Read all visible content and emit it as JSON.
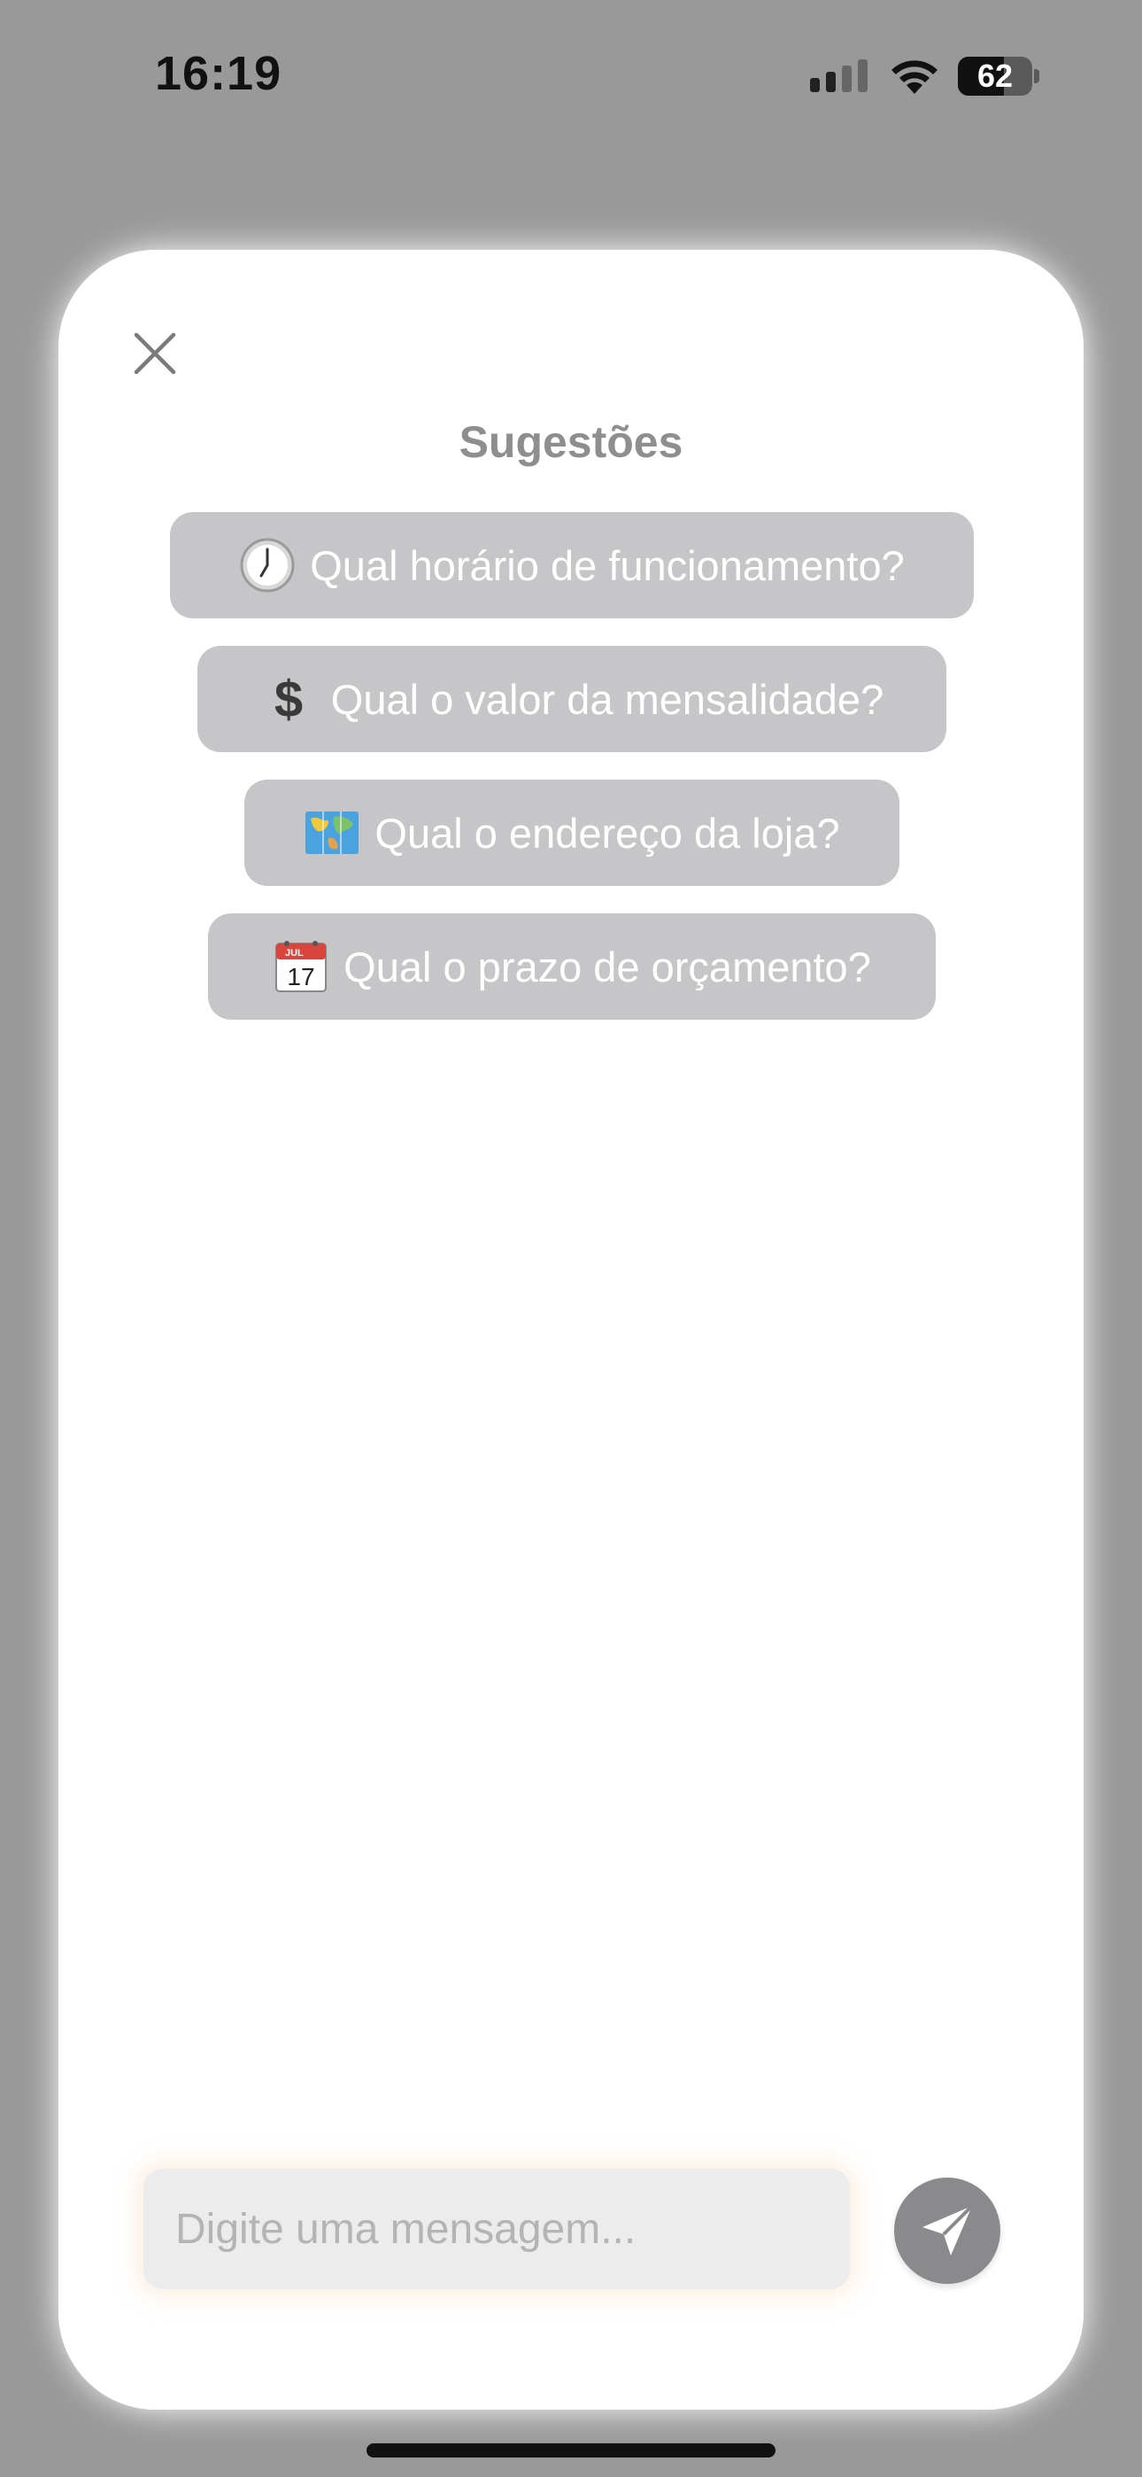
{
  "status_bar": {
    "time": "16:19",
    "battery_percent": "62",
    "battery_level": 0.62
  },
  "dialog": {
    "title": "Sugestões",
    "suggestions": [
      {
        "icon": "clock-icon",
        "label": "Qual horário de funcionamento?"
      },
      {
        "icon": "dollar-icon",
        "label": "Qual o valor da mensalidade?"
      },
      {
        "icon": "map-icon",
        "label": "Qual o endereço da loja?"
      },
      {
        "icon": "calendar-icon",
        "label": "Qual o prazo de orçamento?",
        "calendar_month": "JUL",
        "calendar_day": "17"
      }
    ],
    "input": {
      "placeholder": "Digite uma mensagem..."
    }
  },
  "colors": {
    "chip_background": "#c6c6c8",
    "send_button": "#8a8a8c",
    "title_text": "#8e8e8e"
  }
}
